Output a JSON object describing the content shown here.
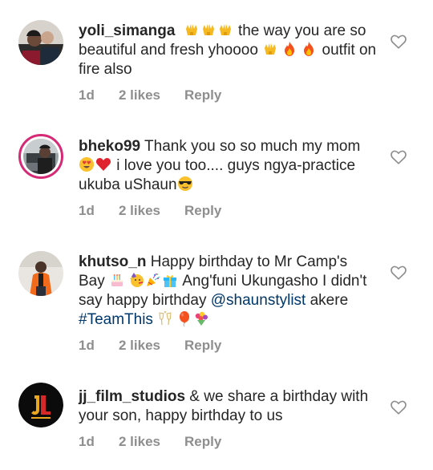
{
  "comments": [
    {
      "username": "yoli_simanga",
      "segments": [
        " the way you are so beautiful and fresh yhoooo ",
        " outfit on fire also"
      ],
      "age": "1d",
      "likes": "2 likes",
      "reply": "Reply"
    },
    {
      "username": "bheko99",
      "segments": [
        " Thank you so so much my mom ",
        " i love you too.... guys ngya-practice ukuba uShaun"
      ],
      "age": "1d",
      "likes": "2 likes",
      "reply": "Reply"
    },
    {
      "username": "khutso_n",
      "segments": [
        " Happy birthday to Mr Camp's Bay ",
        " Ang'funi Ukungasho I didn't say happy birthday ",
        "akere ",
        " "
      ],
      "mention": "@shaunstylist",
      "hashtag": "#TeamThis",
      "age": "1d",
      "likes": "2 likes",
      "reply": "Reply"
    },
    {
      "username": "jj_film_studios",
      "segments": [
        " & we share a birthday with your son, happy birthday to us"
      ],
      "age": "1d",
      "likes": "2 likes",
      "reply": "Reply"
    }
  ],
  "icons": {
    "like": "heart-outline-icon",
    "emojis": [
      "raising-hands-emoji",
      "fire-emoji",
      "heart-eyes-emoji",
      "red-heart-emoji",
      "sunglasses-emoji",
      "birthday-cake-emoji",
      "party-face-emoji",
      "party-popper-emoji",
      "gift-emoji",
      "clinking-glasses-emoji",
      "balloon-emoji",
      "bouquet-emoji"
    ]
  },
  "colors": {
    "text": "#262626",
    "muted": "#8e8e8e",
    "link": "#00376b",
    "story_ring": "#d62976"
  }
}
